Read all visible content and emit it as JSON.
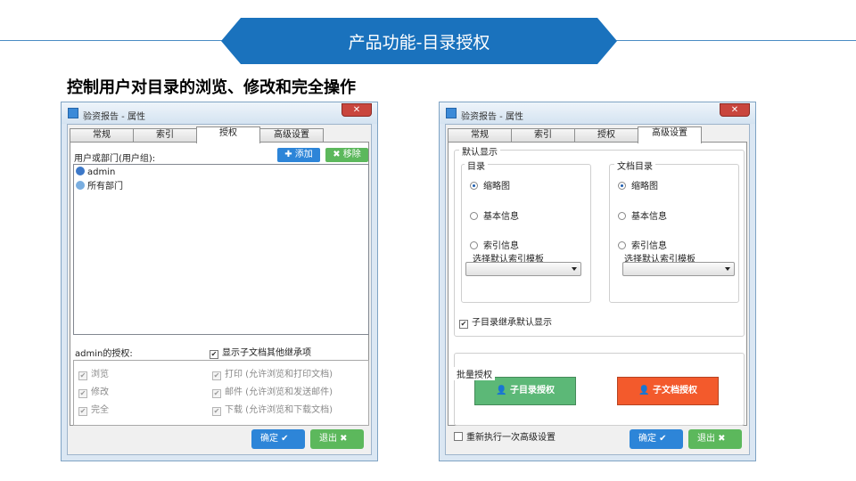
{
  "banner": {
    "title": "产品功能-目录授权"
  },
  "subtitle": "控制用户对目录的浏览、修改和完全操作",
  "left_window": {
    "title": "验资报告 - 属性",
    "close_glyph": "✕",
    "tabs": [
      "常规",
      "索引",
      "授权",
      "高级设置"
    ],
    "active_tab": "授权",
    "users_label": "用户或部门(用户组):",
    "add_button": "✚ 添加",
    "remove_button": "✖ 移除",
    "list_items": [
      {
        "label": "admin",
        "icon_color": "#3c78c8"
      },
      {
        "label": "所有部门",
        "icon_color": "#7aaee0"
      }
    ],
    "perm_label": "admin的授权:",
    "show_inherit_label": "显示子文档其他继承项",
    "permissions": [
      {
        "label": "浏览",
        "checked": true
      },
      {
        "label": "修改",
        "checked": true
      },
      {
        "label": "完全",
        "checked": true
      },
      {
        "label": "打印 (允许浏览和打印文档)",
        "checked": true
      },
      {
        "label": "邮件 (允许浏览和发送邮件)",
        "checked": true
      },
      {
        "label": "下载 (允许浏览和下载文档)",
        "checked": true
      }
    ],
    "ok_button": "确定 ✔",
    "exit_button": "退出 ✖"
  },
  "right_window": {
    "title": "验资报告 - 属性",
    "close_glyph": "✕",
    "tabs": [
      "常规",
      "索引",
      "授权",
      "高级设置"
    ],
    "active_tab": "高级设置",
    "default_display_label": "默认显示",
    "dir_group": {
      "label": "目录",
      "options": [
        "缩略图",
        "基本信息",
        "索引信息"
      ],
      "selected": "缩略图",
      "template_label": "选择默认索引模板"
    },
    "doc_group": {
      "label": "文档目录",
      "options": [
        "缩略图",
        "基本信息",
        "索引信息"
      ],
      "selected": "缩略图",
      "template_label": "选择默认索引模板"
    },
    "inherit_label": "子目录继承默认显示",
    "batch_label": "批量授权",
    "sub_dir_button": "子目录授权",
    "sub_doc_button": "子文档授权",
    "rerun_label": "重新执行一次高级设置",
    "ok_button": "确定 ✔",
    "exit_button": "退出 ✖"
  },
  "colors": {
    "banner": "#1a72bd",
    "button_blue": "#2d85d8",
    "button_green": "#5cb85c",
    "auth_green": "#5cb877",
    "auth_orange": "#f35a2c"
  }
}
